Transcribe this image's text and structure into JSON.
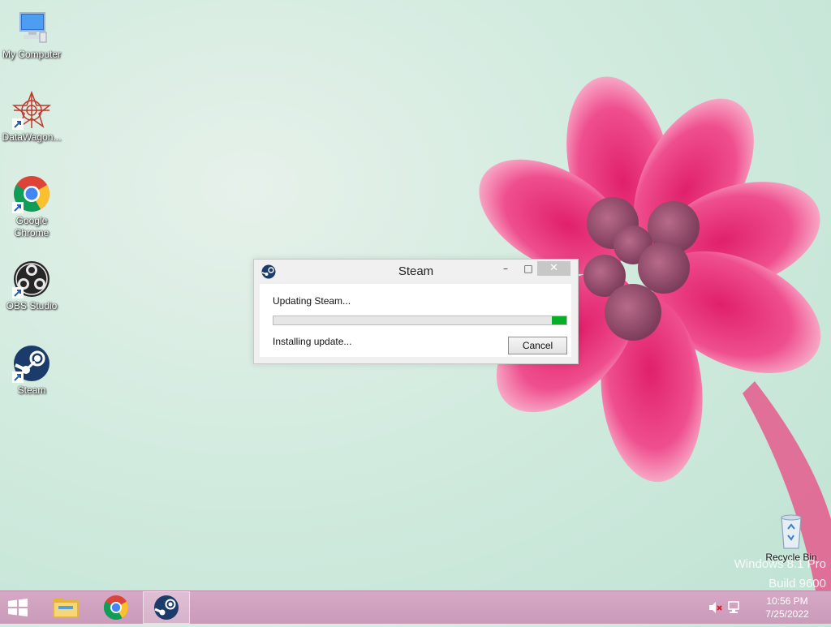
{
  "desktop": {
    "icons": [
      {
        "label": "My Computer",
        "icon": "computer-icon"
      },
      {
        "label": "DataWagon...",
        "icon": "datawagon-icon"
      },
      {
        "label": "Google Chrome",
        "icon": "chrome-icon"
      },
      {
        "label": "OBS Studio",
        "icon": "obs-icon"
      },
      {
        "label": "Steam",
        "icon": "steam-icon"
      },
      {
        "label": "Recycle Bin",
        "icon": "recycle-bin-icon"
      }
    ],
    "watermark": {
      "line1": "Windows 8.1 Pro",
      "line2": "Build 9600"
    }
  },
  "dialog": {
    "title": "Steam",
    "minimize_glyph": "–",
    "maximize_glyph": "□",
    "close_glyph": "✕",
    "status_line1": "Updating Steam...",
    "status_line2": "Installing update...",
    "progress_fraction": 0.05,
    "progress_color": "#06b025",
    "cancel_label": "Cancel"
  },
  "taskbar": {
    "apps": [
      {
        "name": "File Explorer",
        "icon": "folder-icon"
      },
      {
        "name": "Google Chrome",
        "icon": "chrome-icon"
      },
      {
        "name": "Steam",
        "icon": "steam-icon",
        "active": true
      }
    ],
    "tray": [
      "volume-muted-icon",
      "network-icon"
    ],
    "time": "10:56 PM",
    "date": "7/25/2022",
    "color": "#d6a9c6"
  }
}
